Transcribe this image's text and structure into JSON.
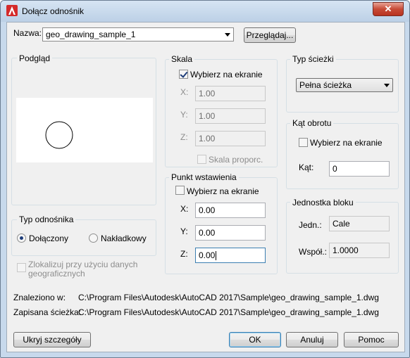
{
  "window": {
    "title": "Dołącz odnośnik",
    "close_label": "✕"
  },
  "name": {
    "label": "Nazwa:",
    "value": "geo_drawing_sample_1",
    "browse_label": "Przeglądaj..."
  },
  "preview": {
    "label": "Podgląd"
  },
  "scale": {
    "label": "Skala",
    "specify_on_screen": "Wybierz na ekranie",
    "specify_checked": true,
    "x_label": "X:",
    "x_value": "1.00",
    "y_label": "Y:",
    "y_value": "1.00",
    "z_label": "Z:",
    "z_value": "1.00",
    "uniform_label": "Skala proporc."
  },
  "insertion": {
    "label": "Punkt wstawienia",
    "specify_on_screen": "Wybierz na ekranie",
    "specify_checked": false,
    "x_label": "X:",
    "x_value": "0.00",
    "y_label": "Y:",
    "y_value": "0.00",
    "z_label": "Z:",
    "z_value": "0.00"
  },
  "path_type": {
    "label": "Typ ścieżki",
    "value": "Pełna ścieżka"
  },
  "rotation": {
    "label": "Kąt obrotu",
    "specify_on_screen": "Wybierz na ekranie",
    "specify_checked": false,
    "angle_label": "Kąt:",
    "angle_value": "0"
  },
  "block_unit": {
    "label": "Jednostka bloku",
    "unit_label": "Jedn.:",
    "unit_value": "Cale",
    "factor_label": "Współ.:",
    "factor_value": "1.0000"
  },
  "reference_type": {
    "label": "Typ odnośnika",
    "attachment": "Dołączony",
    "overlay": "Nakładkowy",
    "selected": "attachment"
  },
  "locate_geo": {
    "line1": "Zlokalizuj przy użyciu danych",
    "line2": "geograficznych"
  },
  "found_in": {
    "label": "Znaleziono w:",
    "value": "C:\\Program Files\\Autodesk\\AutoCAD 2017\\Sample\\geo_drawing_sample_1.dwg"
  },
  "saved_path": {
    "label": "Zapisana ścieżka:",
    "value": "C:\\Program Files\\Autodesk\\AutoCAD 2017\\Sample\\geo_drawing_sample_1.dwg"
  },
  "buttons": {
    "hide_details": "Ukryj szczegóły",
    "ok": "OK",
    "cancel": "Anuluj",
    "help": "Pomoc"
  },
  "colors": {
    "accent": "#cc2222",
    "title_bg": "#c7d9ec",
    "dialog_bg": "#f0f0f0"
  }
}
